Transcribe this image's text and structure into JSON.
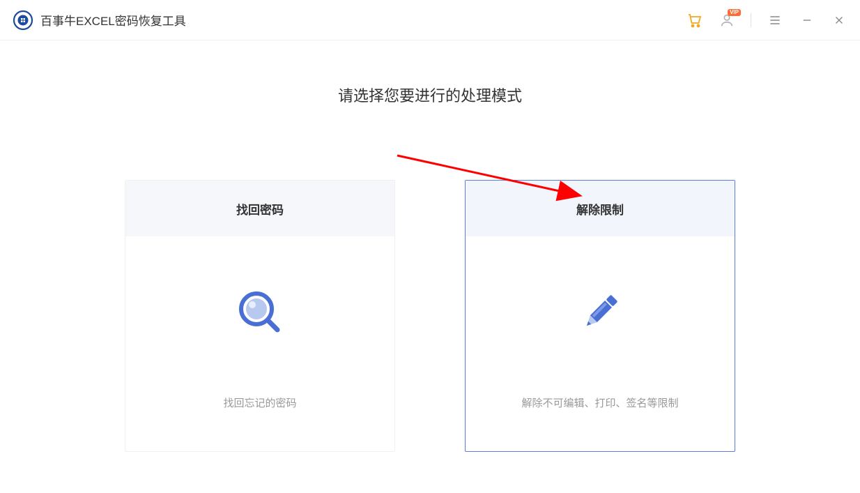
{
  "header": {
    "app_title": "百事牛EXCEL密码恢复工具",
    "vip_badge": "VIP"
  },
  "main": {
    "heading": "请选择您要进行的处理模式"
  },
  "cards": {
    "recover": {
      "title": "找回密码",
      "description": "找回忘记的密码"
    },
    "remove": {
      "title": "解除限制",
      "description": "解除不可编辑、打印、签名等限制"
    }
  }
}
